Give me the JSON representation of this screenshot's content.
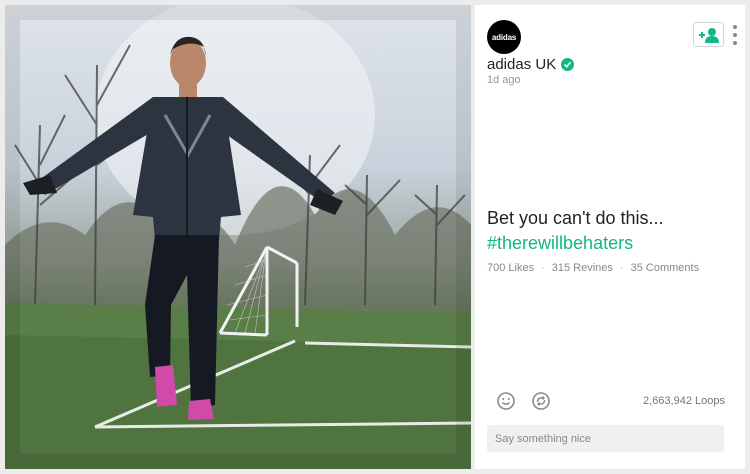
{
  "post": {
    "author": "adidas UK",
    "avatar_text": "adidas",
    "time": "1d ago",
    "caption": "Bet you can't do this...",
    "hashtag": "#therewillbehaters"
  },
  "stats": {
    "likes": "700 Likes",
    "revines": "315 Revines",
    "comments": "35 Comments",
    "loops": "2,663,942 Loops"
  },
  "comment_box": {
    "placeholder": "Say something nice"
  },
  "icons": {
    "follow": "add-user-icon",
    "more": "vertical-dots-icon",
    "verified": "verified-check-icon",
    "like": "smiley-icon",
    "revine": "revine-icon"
  },
  "colors": {
    "accent": "#13b687",
    "panel_bg": "#ffffff",
    "page_bg": "#ececec"
  }
}
